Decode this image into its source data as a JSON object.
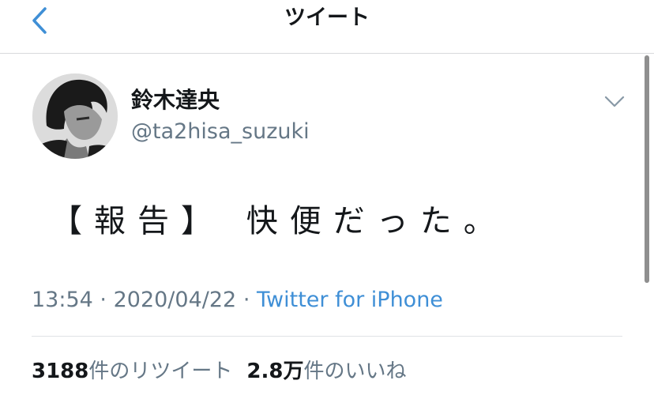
{
  "header": {
    "title": "ツイート",
    "back_icon": "chevron-left-icon",
    "accent": "#3f8fd6"
  },
  "user": {
    "display_name": "鈴木達央",
    "handle": "@ta2hisa_suzuki",
    "avatar_icon": "profile-photo"
  },
  "tweet": {
    "text": "【報告】 快便だった。",
    "options_icon": "chevron-down-icon"
  },
  "meta": {
    "time": "13:54",
    "separator": "·",
    "date": "2020/04/22",
    "source": "Twitter for iPhone"
  },
  "stats": {
    "retweets_count": "3188",
    "retweets_label": "件のリツイート",
    "likes_count": "2.8万",
    "likes_label": "件のいいね"
  }
}
